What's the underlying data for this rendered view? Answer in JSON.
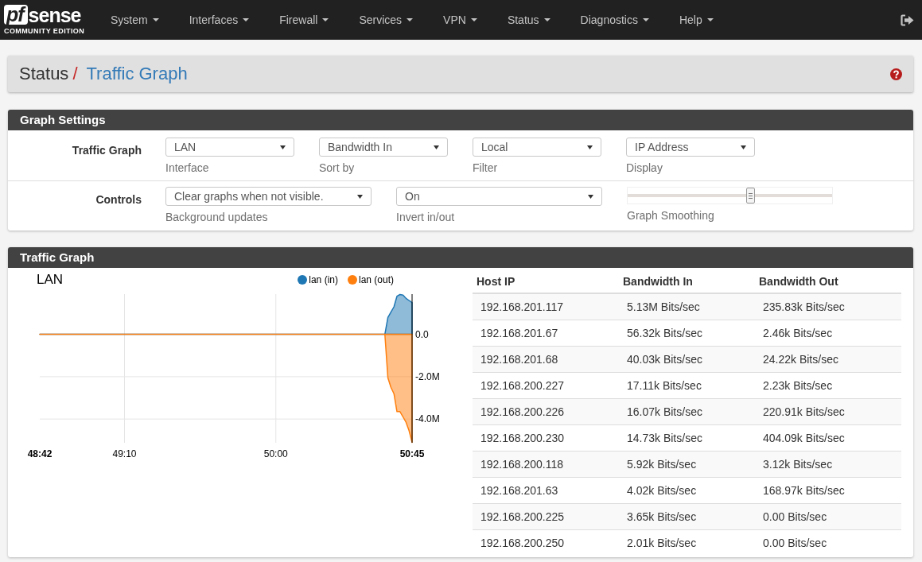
{
  "navbar": {
    "logo": {
      "mark": "pf",
      "wordmark": "sense",
      "edition": "COMMUNITY EDITION"
    },
    "menu": [
      "System",
      "Interfaces",
      "Firewall",
      "Services",
      "VPN",
      "Status",
      "Diagnostics",
      "Help"
    ]
  },
  "breadcrumb": {
    "section": "Status",
    "separator": "/",
    "page": "Traffic Graph"
  },
  "graph_settings": {
    "title": "Graph Settings",
    "rows": [
      {
        "label": "Traffic Graph",
        "controls": [
          {
            "kind": "select",
            "value": "LAN",
            "help": "Interface"
          },
          {
            "kind": "select",
            "value": "Bandwidth In",
            "help": "Sort by"
          },
          {
            "kind": "select",
            "value": "Local",
            "help": "Filter"
          },
          {
            "kind": "select",
            "value": "IP Address",
            "help": "Display"
          }
        ]
      },
      {
        "label": "Controls",
        "controls": [
          {
            "kind": "select",
            "value": "Clear graphs when not visible.",
            "help": "Background updates"
          },
          {
            "kind": "select",
            "value": "On",
            "help": "Invert in/out"
          },
          {
            "kind": "slider",
            "level": 0.6,
            "help": "Graph Smoothing"
          }
        ]
      }
    ]
  },
  "traffic_graph": {
    "title": "Traffic Graph",
    "chart_data": [
      {
        "type": "area",
        "title": "LAN",
        "legend": "top-right",
        "grid": true,
        "x": [
          2922,
          3036,
          3037,
          3038,
          3039,
          3040,
          3041,
          3042,
          3043,
          3044,
          3045
        ],
        "xlim": [
          2922,
          3045
        ],
        "xticks": [
          {
            "value": 2922,
            "label": "48:42"
          },
          {
            "value": 2950,
            "label": "49:10"
          },
          {
            "value": 3000,
            "label": "50:00"
          },
          {
            "value": 3045,
            "label": "50:45"
          }
        ],
        "yticks": [
          {
            "value": 0,
            "label": "0.0"
          },
          {
            "value": -2,
            "label": "-2.0M"
          },
          {
            "value": -4,
            "label": "-4.0M"
          }
        ],
        "ylim": [
          -5.12,
          1.9
        ],
        "series": [
          {
            "name": "lan (in)",
            "color": "#1f77b4",
            "values": [
              0,
              0,
              0.8,
              1.05,
              1.3,
              1.8,
              1.88,
              1.85,
              1.7,
              1.6,
              1.5
            ]
          },
          {
            "name": "lan (out)",
            "color": "#ff7f0e",
            "values": [
              0,
              0,
              -2.05,
              -2.5,
              -2.8,
              -3.65,
              -3.65,
              -3.9,
              -4.15,
              -4.55,
              -5.1
            ]
          }
        ]
      }
    ],
    "table": {
      "columns": [
        "Host IP",
        "Bandwidth In",
        "Bandwidth Out"
      ],
      "rows": [
        [
          "192.168.201.117",
          "5.13M Bits/sec",
          "235.83k Bits/sec"
        ],
        [
          "192.168.201.67",
          "56.32k Bits/sec",
          "2.46k Bits/sec"
        ],
        [
          "192.168.201.68",
          "40.03k Bits/sec",
          "24.22k Bits/sec"
        ],
        [
          "192.168.200.227",
          "17.11k Bits/sec",
          "2.23k Bits/sec"
        ],
        [
          "192.168.200.226",
          "16.07k Bits/sec",
          "220.91k Bits/sec"
        ],
        [
          "192.168.200.230",
          "14.73k Bits/sec",
          "404.09k Bits/sec"
        ],
        [
          "192.168.200.118",
          "5.92k Bits/sec",
          "3.12k Bits/sec"
        ],
        [
          "192.168.201.63",
          "4.02k Bits/sec",
          "168.97k Bits/sec"
        ],
        [
          "192.168.200.225",
          "3.65k Bits/sec",
          "0.00 Bits/sec"
        ],
        [
          "192.168.200.250",
          "2.01k Bits/sec",
          "0.00 Bits/sec"
        ]
      ]
    }
  }
}
